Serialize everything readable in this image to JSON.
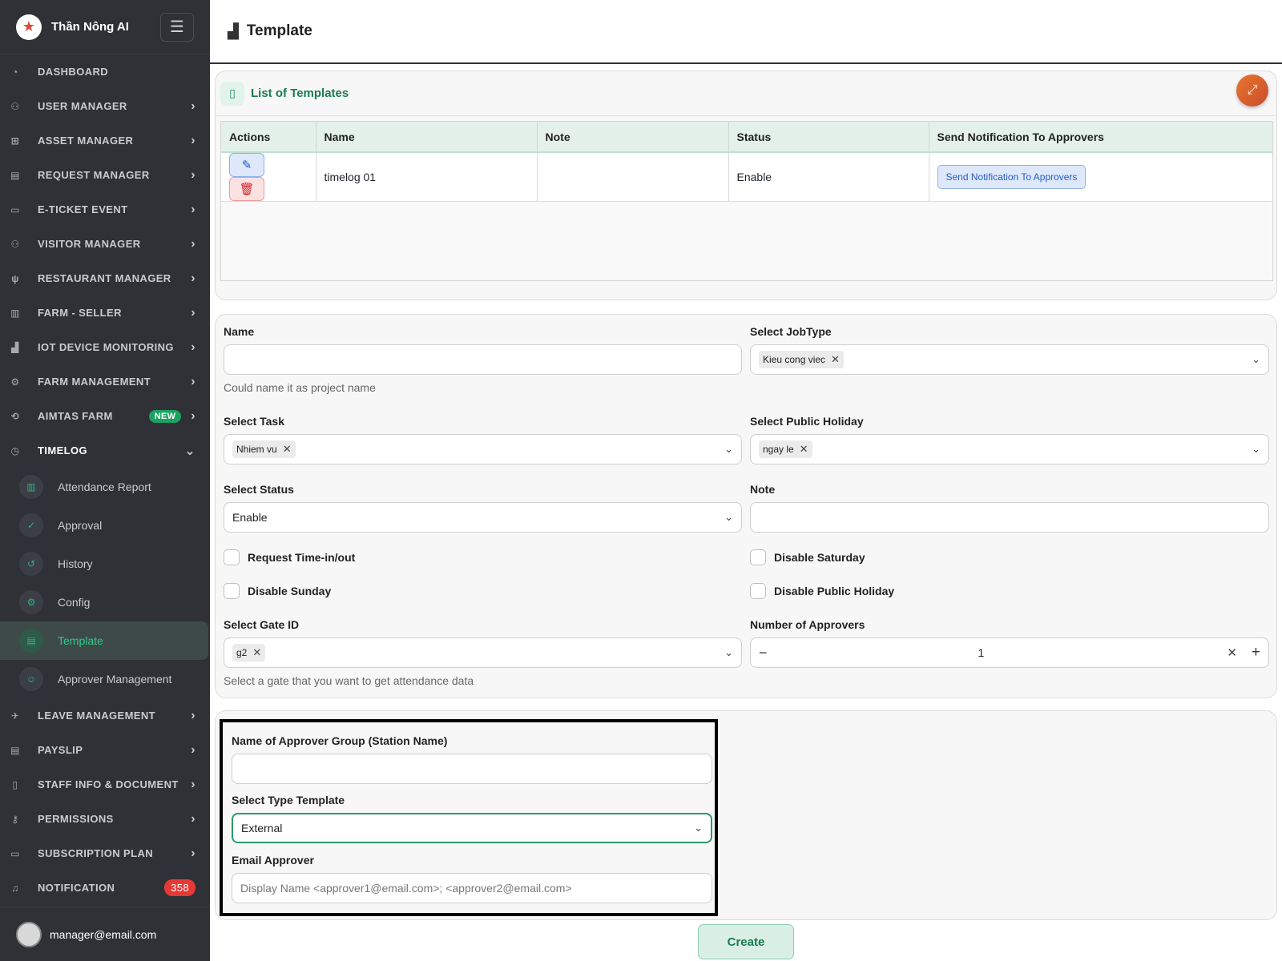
{
  "sidebar": {
    "brand": "Thần Nông AI",
    "menu_icon": "hamburger-icon",
    "items": [
      {
        "label": "DASHBOARD"
      },
      {
        "label": "USER MANAGER"
      },
      {
        "label": "ASSET MANAGER"
      },
      {
        "label": "REQUEST MANAGER"
      },
      {
        "label": "E-TICKET EVENT"
      },
      {
        "label": "VISITOR MANAGER"
      },
      {
        "label": "RESTAURANT MANAGER"
      },
      {
        "label": "FARM - SELLER"
      },
      {
        "label": "IOT DEVICE MONITORING"
      },
      {
        "label": "FARM MANAGEMENT"
      },
      {
        "label": "AIMTAS FARM",
        "badge": "NEW"
      },
      {
        "label": "TIMELOG"
      }
    ],
    "timelog_sub": [
      {
        "label": "Attendance Report"
      },
      {
        "label": "Approval"
      },
      {
        "label": "History"
      },
      {
        "label": "Config"
      },
      {
        "label": "Template"
      },
      {
        "label": "Approver Management"
      }
    ],
    "items_after": [
      {
        "label": "LEAVE MANAGEMENT"
      },
      {
        "label": "PAYSLIP"
      },
      {
        "label": "STAFF INFO & DOCUMENT"
      },
      {
        "label": "PERMISSIONS"
      },
      {
        "label": "SUBSCRIPTION PLAN"
      },
      {
        "label": "NOTIFICATION",
        "badge": "358"
      }
    ],
    "user_email": "manager@email.com"
  },
  "header": {
    "title": "Template"
  },
  "list": {
    "title": "List of Templates",
    "columns": [
      "Actions",
      "Name",
      "Note",
      "Status",
      "Send Notification To Approvers"
    ],
    "rows": [
      {
        "name": "timelog 01",
        "note": "",
        "status": "Enable",
        "notify_label": "Send Notification To Approvers"
      }
    ]
  },
  "form": {
    "name_label": "Name",
    "name_value": "",
    "name_help": "Could name it as project name",
    "jobtype_label": "Select JobType",
    "jobtype_chip": "Kieu cong viec",
    "task_label": "Select Task",
    "task_chip": "Nhiem vu",
    "holiday_label": "Select Public Holiday",
    "holiday_chip": "ngay le",
    "status_label": "Select Status",
    "status_value": "Enable",
    "note_label": "Note",
    "note_value": "",
    "chk_request": "Request Time-in/out",
    "chk_saturday": "Disable Saturday",
    "chk_sunday": "Disable Sunday",
    "chk_holiday": "Disable Public Holiday",
    "gate_label": "Select Gate ID",
    "gate_chip": "g2",
    "gate_help": "Select a gate that you want to get attendance data",
    "approvers_label": "Number of Approvers",
    "approvers_value": "1"
  },
  "approver_group": {
    "group_label": "Name of Approver Group (Station Name)",
    "group_value": "",
    "type_label": "Select Type Template",
    "type_value": "External",
    "email_label": "Email Approver",
    "email_placeholder": "Display Name <approver1@email.com>; <approver2@email.com>"
  },
  "create_label": "Create"
}
